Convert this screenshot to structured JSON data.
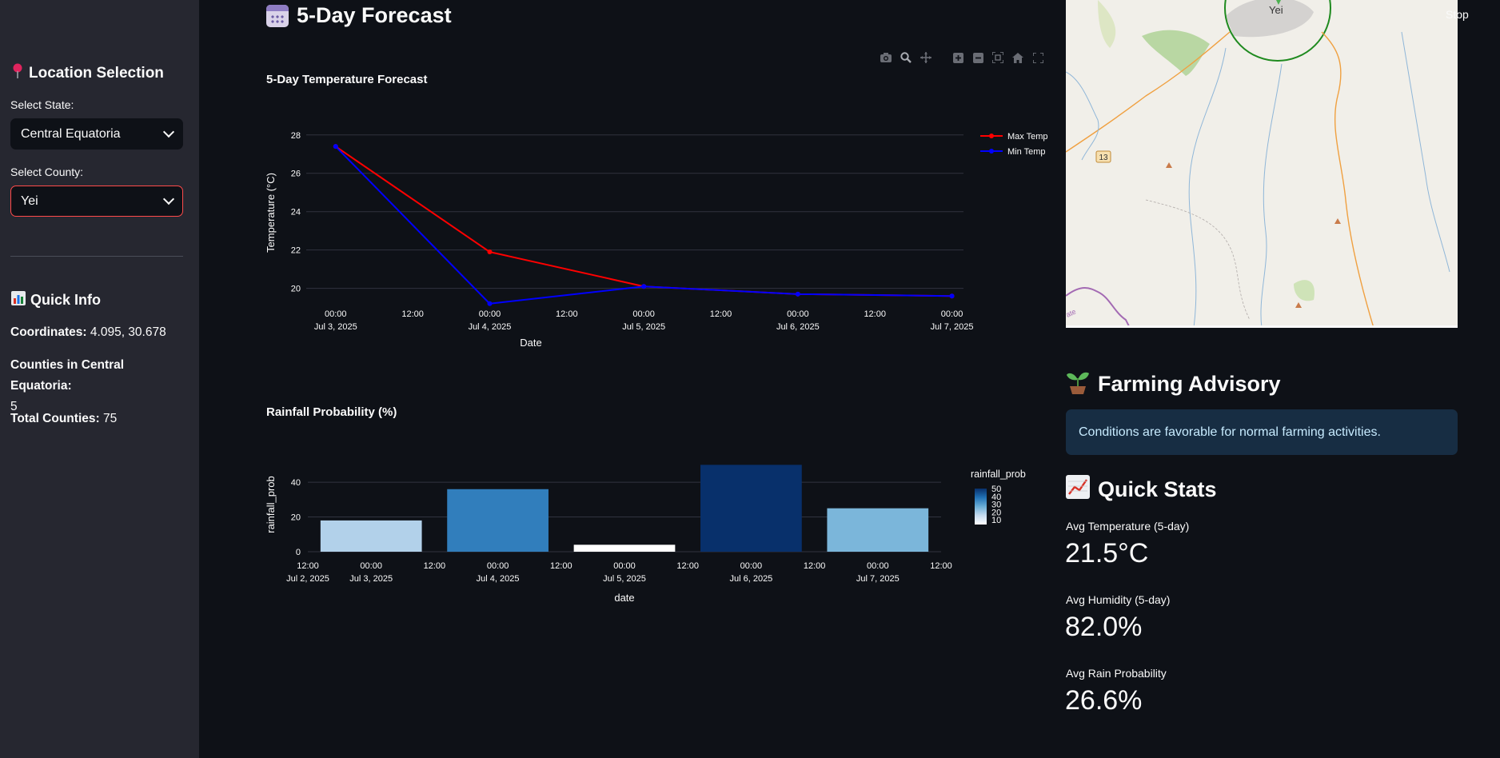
{
  "sidebar": {
    "location_heading": "Location Selection",
    "location_icon": "round-pushpin-icon",
    "state_label": "Select State:",
    "state_value": "Central Equatoria",
    "county_label": "Select County:",
    "county_value": "Yei",
    "quick_info_heading": "Quick Info",
    "quick_info_icon": "bar-chart-icon",
    "coordinates_label": "Coordinates:",
    "coordinates_value": "4.095, 30.678",
    "counties_in_label": "Counties in Central Equatoria:",
    "counties_in_value": "5",
    "total_counties_label": "Total Counties:",
    "total_counties_value": "75"
  },
  "main": {
    "forecast_heading": "5-Day Forecast",
    "forecast_icon": "calendar-icon"
  },
  "modebar": [
    "camera-icon",
    "zoom-icon",
    "pan-icon",
    "zoom-in-icon",
    "zoom-out-icon",
    "autoscale-icon",
    "reset-axes-icon",
    "fullscreen-icon"
  ],
  "chart_data": [
    {
      "type": "line",
      "title": "5-Day Temperature Forecast",
      "xlabel": "Date",
      "ylabel": "Temperature (°C)",
      "x": [
        "2025-07-03 00:00",
        "2025-07-04 00:00",
        "2025-07-05 00:00",
        "2025-07-06 00:00",
        "2025-07-07 00:00"
      ],
      "x_ticks": [
        {
          "line1": "00:00",
          "line2": "Jul 3, 2025"
        },
        {
          "line1": "12:00",
          "line2": ""
        },
        {
          "line1": "00:00",
          "line2": "Jul 4, 2025"
        },
        {
          "line1": "12:00",
          "line2": ""
        },
        {
          "line1": "00:00",
          "line2": "Jul 5, 2025"
        },
        {
          "line1": "12:00",
          "line2": ""
        },
        {
          "line1": "00:00",
          "line2": "Jul 6, 2025"
        },
        {
          "line1": "12:00",
          "line2": ""
        },
        {
          "line1": "00:00",
          "line2": "Jul 7, 2025"
        }
      ],
      "y_ticks": [
        20,
        22,
        24,
        26,
        28
      ],
      "ylim": [
        18.9,
        29.2
      ],
      "grid": true,
      "legend_position": "top-right",
      "series": [
        {
          "name": "Max Temp",
          "color": "#ff0000",
          "values": [
            27.4,
            21.9,
            20.1,
            19.7,
            19.6
          ]
        },
        {
          "name": "Min Temp",
          "color": "#0000ff",
          "values": [
            27.4,
            19.2,
            20.1,
            19.7,
            19.6
          ]
        }
      ]
    },
    {
      "type": "bar",
      "title": "Rainfall Probability (%)",
      "xlabel": "date",
      "ylabel": "rainfall_prob",
      "x": [
        "2025-07-03",
        "2025-07-04",
        "2025-07-05",
        "2025-07-06",
        "2025-07-07"
      ],
      "values": [
        18,
        36,
        4,
        50,
        25
      ],
      "x_ticks": [
        {
          "line1": "12:00",
          "line2": "Jul 2, 2025"
        },
        {
          "line1": "00:00",
          "line2": "Jul 3, 2025"
        },
        {
          "line1": "12:00",
          "line2": ""
        },
        {
          "line1": "00:00",
          "line2": "Jul 4, 2025"
        },
        {
          "line1": "12:00",
          "line2": ""
        },
        {
          "line1": "00:00",
          "line2": "Jul 5, 2025"
        },
        {
          "line1": "12:00",
          "line2": ""
        },
        {
          "line1": "00:00",
          "line2": "Jul 6, 2025"
        },
        {
          "line1": "12:00",
          "line2": ""
        },
        {
          "line1": "00:00",
          "line2": "Jul 7, 2025"
        },
        {
          "line1": "12:00",
          "line2": ""
        }
      ],
      "y_ticks": [
        0,
        20,
        40
      ],
      "ylim": [
        0,
        52
      ],
      "grid": true,
      "colorscale": "Blues",
      "colorbar": {
        "title": "rainfall_prob",
        "ticks": [
          50,
          40,
          30,
          20,
          10
        ],
        "range": [
          4,
          50
        ]
      }
    }
  ],
  "map": {
    "town_label": "Yei",
    "road_shield": "13",
    "partial_label": "ate"
  },
  "header": {
    "stop_label": "Stop"
  },
  "advisory": {
    "heading": "Farming Advisory",
    "icon": "seedling-icon",
    "message": "Conditions are favorable for normal farming activities."
  },
  "stats": {
    "heading": "Quick Stats",
    "icon": "chart-increasing-icon",
    "items": [
      {
        "label": "Avg Temperature (5-day)",
        "value": "21.5°C"
      },
      {
        "label": "Avg Humidity (5-day)",
        "value": "82.0%"
      },
      {
        "label": "Avg Rain Probability",
        "value": "26.6%"
      }
    ]
  }
}
